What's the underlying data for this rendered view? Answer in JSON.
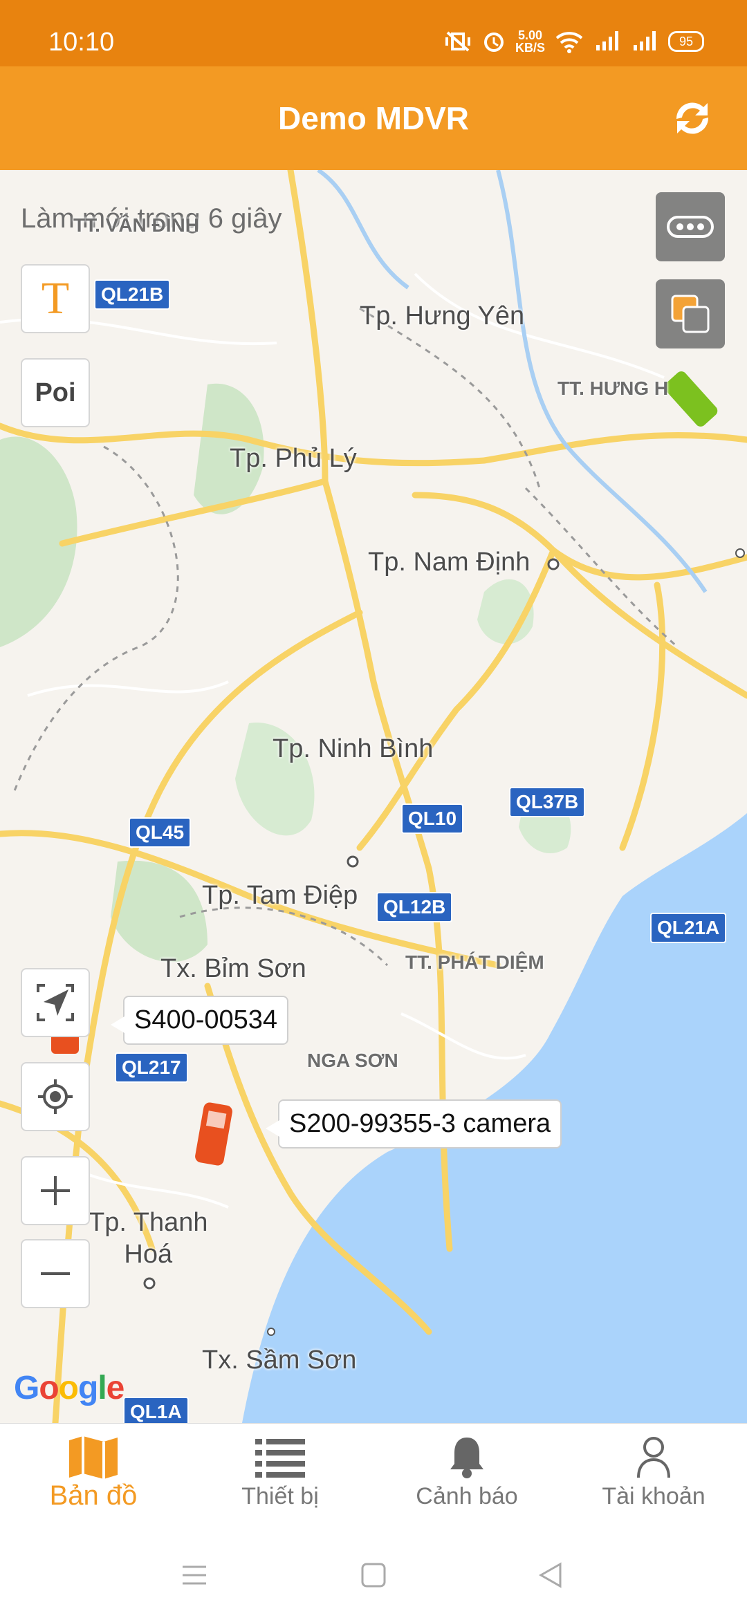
{
  "status_bar": {
    "time": "10:10",
    "speed_value": "5.00",
    "speed_unit": "KB/S",
    "battery": "95"
  },
  "header": {
    "title": "Demo MDVR",
    "refresh_icon": "refresh-icon"
  },
  "map": {
    "refresh_notice": "Làm mới trong 6 giây",
    "text_tool_label": "T",
    "poi_label": "Poi",
    "places": {
      "van_dinh": "TT. VÂN ĐÌNH",
      "hung_yen": "Tp. Hưng Yên",
      "hung_ha": "TT. HƯNG H",
      "phu_ly": "Tp. Phủ Lý",
      "nam_dinh": "Tp. Nam Định",
      "ninh_binh": "Tp. Ninh Bình",
      "tam_diep": "Tp. Tam Điệp",
      "bim_son": "Tx. Bỉm Sơn",
      "phat_diem": "TT. PHÁT DIỆM",
      "nga_son": "NGA SƠN",
      "thanh_hoa": "Tp. Thanh\nHoá",
      "sam_son": "Tx. Sầm Sơn"
    },
    "roads": [
      "QL21B",
      "QL45",
      "QL10",
      "QL37B",
      "QL12B",
      "QL21A",
      "QL217",
      "QL1A"
    ],
    "vehicles": [
      {
        "label": "S400-00534",
        "color": "#e8501f"
      },
      {
        "label": "S200-99355-3 camera",
        "color": "#e8501f"
      },
      {
        "label": "",
        "color": "#7cc11f"
      }
    ],
    "attribution": "Google"
  },
  "bottom_nav": {
    "items": [
      {
        "label": "Bản đồ",
        "icon": "map-icon",
        "active": true
      },
      {
        "label": "Thiết bị",
        "icon": "list-icon",
        "active": false
      },
      {
        "label": "Cảnh báo",
        "icon": "bell-icon",
        "active": false
      },
      {
        "label": "Tài khoản",
        "icon": "user-icon",
        "active": false
      }
    ]
  }
}
